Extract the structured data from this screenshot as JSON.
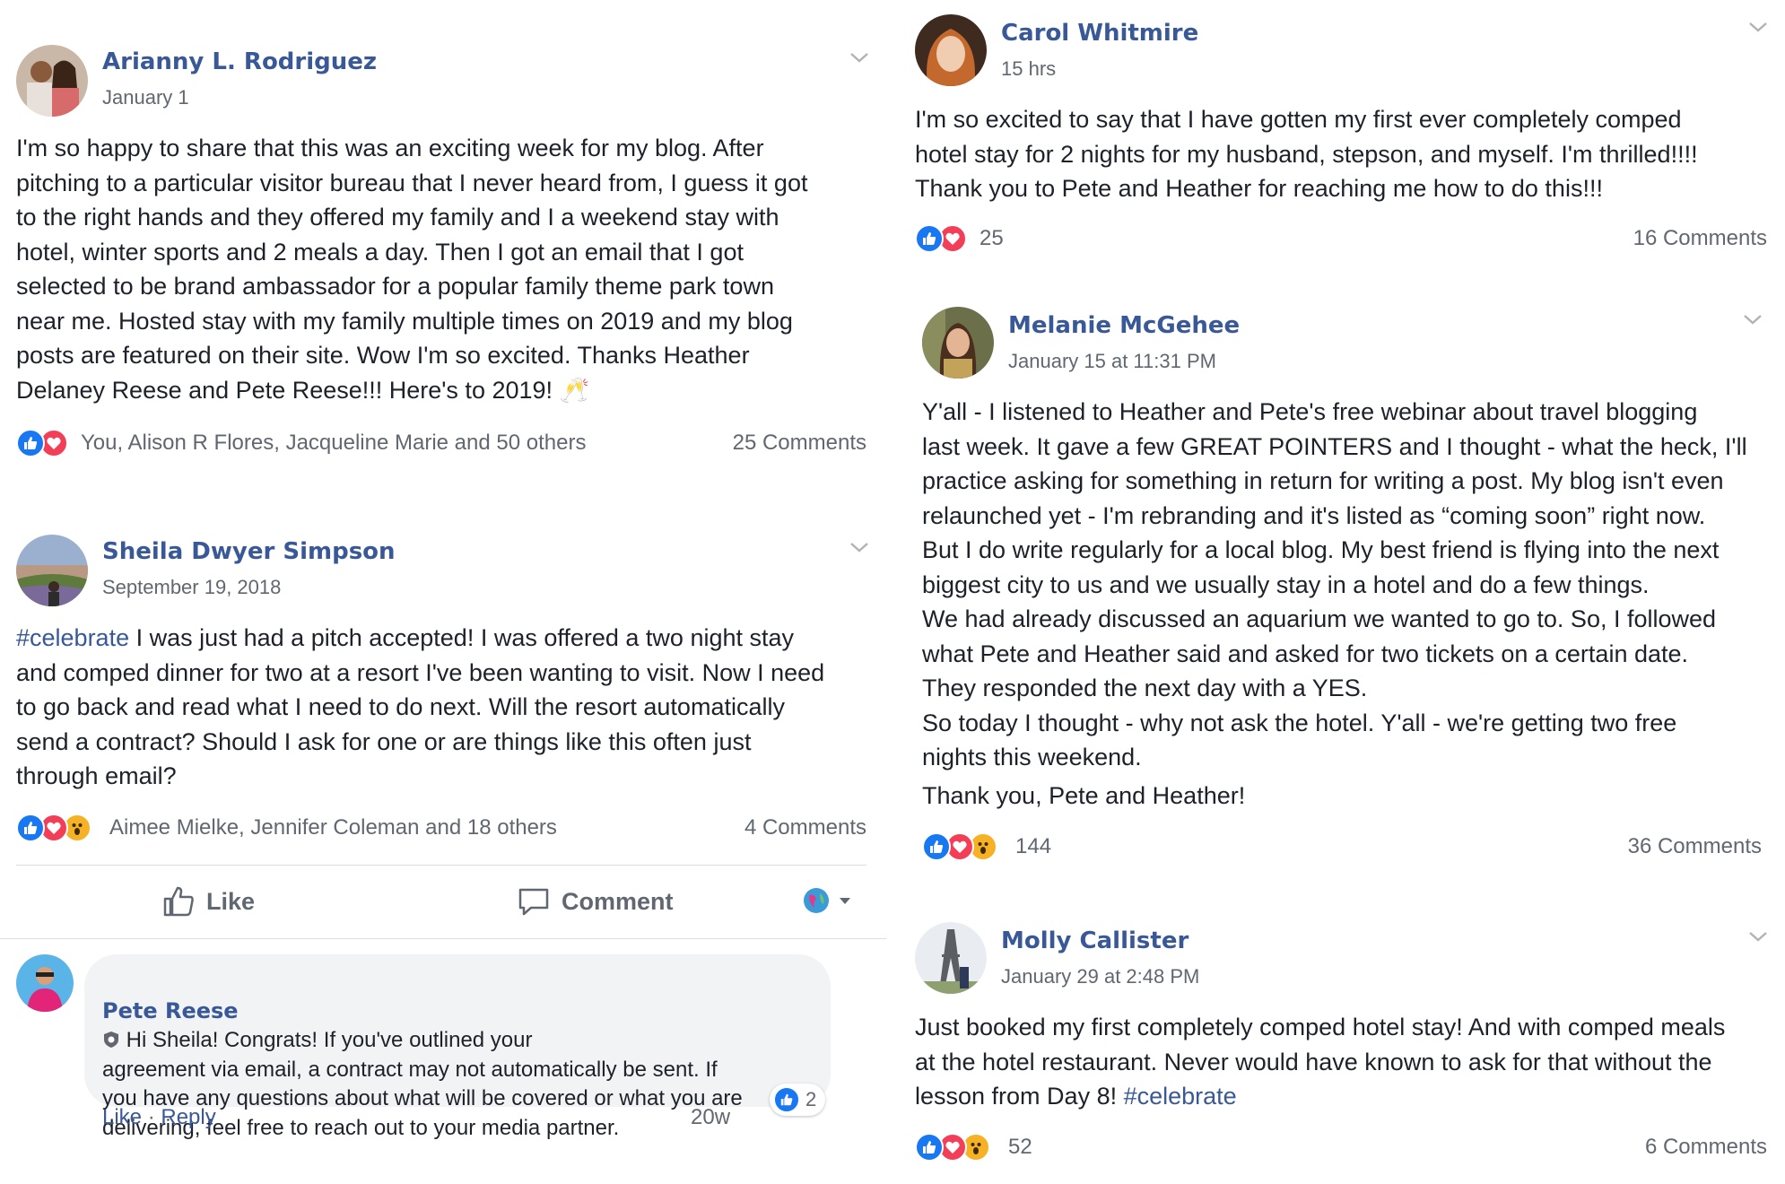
{
  "colors": {
    "link": "#385898",
    "text": "#1d2129",
    "meta": "#616770",
    "like": "#1877f2",
    "love": "#f33e58",
    "wow": "#f7b125"
  },
  "posts": [
    {
      "author": "Arianny L. Rodriguez",
      "time": "January 1",
      "text": "I'm so happy to share that this was an exciting week for my blog. After\npitching to a particular visitor bureau that I never heard from, I guess it got\nto the right hands and they offered my family and I a weekend stay with\nhotel, winter sports and 2 meals a day. Then I got an email that I got\nselected to be brand ambassador for a popular family theme park town\nnear me. Hosted stay with my family multiple times on 2019 and my blog\nposts are featured on their site. Wow I'm so excited. Thanks Heather\nDelaney Reese and Pete Reese!!! Here's to 2019!",
      "emoji": "🥂",
      "reactions": "You, Alison R Flores, Jacqueline Marie and 50 others",
      "comments": "25 Comments"
    },
    {
      "author": "Sheila Dwyer Simpson",
      "time": "September 19, 2018",
      "hashtag": "#celebrate",
      "text": " I was just had a pitch accepted! I was offered a two night stay\nand comped dinner for two at a resort I've been wanting to visit. Now I need\nto go back and read what I need to do next. Will the resort automatically\nsend a contract? Should I ask for one or are things like this often just\nthrough email?",
      "reactions": "Aimee Mielke, Jennifer Coleman and 18 others",
      "comments": "4 Comments",
      "actions": {
        "like": "Like",
        "comment": "Comment"
      },
      "reply": {
        "author": "Pete Reese",
        "text": " Hi Sheila! Congrats! If you've outlined your\nagreement via email, a contract may not automatically be sent. If\nyou have any questions about what will be covered or what you are\ndelivering, feel free to reach out to your media partner.",
        "like": "Like",
        "sep": " · ",
        "reply_label": "Reply",
        "time": "20w",
        "reaction_count": "2"
      }
    },
    {
      "author": "Carol Whitmire",
      "time": "15 hrs",
      "text": "I'm so excited to say that I have gotten my first ever completely comped\nhotel stay for 2 nights for my husband, stepson, and myself. I'm thrilled!!!!\nThank you to Pete and Heather for reaching me how to do this!!!",
      "reactions": "25",
      "comments": "16 Comments"
    },
    {
      "author": "Melanie McGehee",
      "time": "January 15 at 11:31 PM",
      "text": "Y'all - I listened to Heather and Pete's free webinar about travel blogging\nlast week. It gave a few GREAT POINTERS and I thought - what the heck, I'll\npractice asking for something in return for writing a post. My blog isn't even\nrelaunched yet - I'm rebranding and it's listed as “coming soon” right now.\nBut I do write regularly for a local blog. My best friend is flying into the next\nbiggest city to us and we usually stay in a hotel and do a few things.\nWe had already discussed an aquarium we wanted to go to. So, I followed\nwhat Pete and Heather said and asked for two tickets on a certain date.\nThey responded the next day with a YES.\nSo today I thought - why not ask the hotel. Y'all - we're getting two free\nnights this weekend.",
      "text2": "Thank you, Pete and Heather!",
      "reactions": "144",
      "comments": "36 Comments"
    },
    {
      "author": "Molly Callister",
      "time": "January 29 at 2:48 PM",
      "text": "Just booked my first completely comped hotel stay! And with comped meals\nat the hotel restaurant. Never would have known to ask for that without the\nlesson from Day 8! ",
      "hashtag": "#celebrate",
      "reactions": "52",
      "comments": "6 Comments"
    }
  ]
}
